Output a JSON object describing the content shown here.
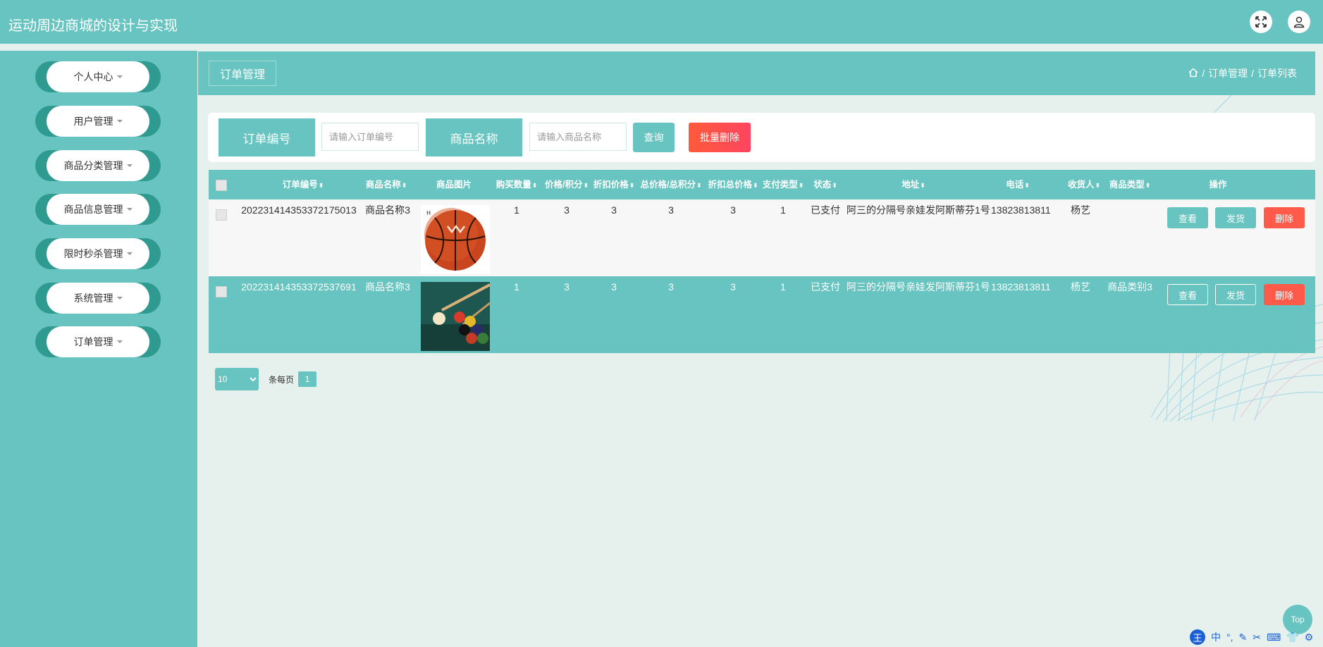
{
  "app": {
    "title": "运动周边商城的设计与实现"
  },
  "topbar": {
    "fullscreen_icon": "expand-icon",
    "user_icon": "user-icon"
  },
  "sidebar": {
    "items": [
      {
        "label": "个人中心"
      },
      {
        "label": "用户管理"
      },
      {
        "label": "商品分类管理"
      },
      {
        "label": "商品信息管理"
      },
      {
        "label": "限时秒杀管理"
      },
      {
        "label": "系统管理"
      },
      {
        "label": "订单管理"
      }
    ]
  },
  "page": {
    "tag": "订单管理",
    "breadcrumb": {
      "home_icon": "home-icon",
      "sep": "/",
      "level1": "订单管理",
      "level2": "订单列表"
    }
  },
  "search": {
    "order_no_label": "订单编号",
    "order_no_placeholder": "请输入订单编号",
    "product_name_label": "商品名称",
    "product_name_placeholder": "请输入商品名称",
    "query_label": "查询",
    "batch_delete_label": "批量删除"
  },
  "table": {
    "headers": [
      "订单编号",
      "商品名称",
      "商品图片",
      "购买数量",
      "价格/积分",
      "折扣价格",
      "总价格/总积分",
      "折扣总价格",
      "支付类型",
      "状态",
      "地址",
      "电话",
      "收货人",
      "商品类型",
      "操作"
    ],
    "rows": [
      {
        "order_no": "2022314143533721750​13",
        "product": "商品名称3",
        "image": "basketball",
        "qty": "1",
        "price": "3",
        "discount_price": "3",
        "total": "3",
        "discount_total": "3",
        "pay_type": "1",
        "status": "已支付",
        "address": "阿三的分隔号亲娃发阿斯蒂芬1号",
        "phone": "13823813811",
        "receiver": "杨艺",
        "category": ""
      },
      {
        "order_no": "202231414353372537691",
        "product": "商品名称3",
        "image": "billiards",
        "qty": "1",
        "price": "3",
        "discount_price": "3",
        "total": "3",
        "discount_total": "3",
        "pay_type": "1",
        "status": "已支付",
        "address": "阿三的分隔号亲娃发阿斯蒂芬1号",
        "phone": "13823813811",
        "receiver": "杨艺",
        "category": "商品类别3"
      }
    ],
    "actions": {
      "view": "查看",
      "ship": "发货",
      "delete": "删除"
    }
  },
  "pagination": {
    "page_size": "10",
    "per_page_label": "条每页",
    "current_page": "1"
  },
  "top_button": {
    "label": "Top"
  },
  "ime": {
    "logo": "王",
    "items": [
      "中",
      "°,",
      "✎",
      "✂",
      "⌨",
      "👕",
      "⚙"
    ]
  },
  "colors": {
    "primary": "#67c4c0",
    "danger": "#ff5a4a",
    "sidebar_accent": "#2f9a8f"
  }
}
